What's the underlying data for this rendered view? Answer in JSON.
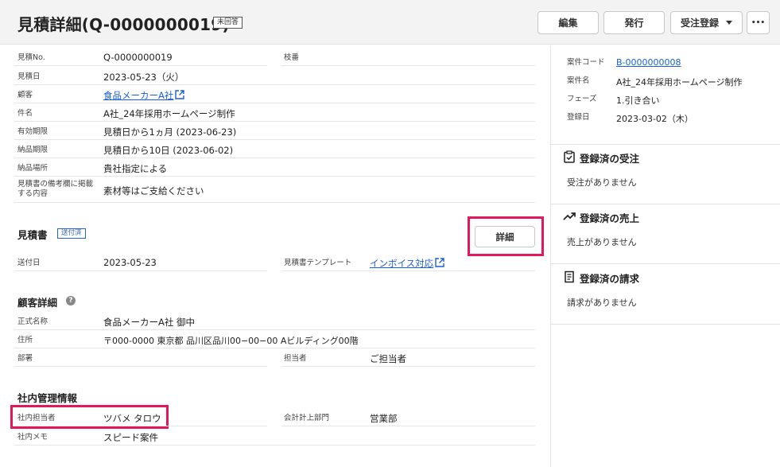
{
  "header": {
    "title": "見積詳細(Q-0000000019)",
    "status_badge": "未回答",
    "buttons": {
      "edit": "編集",
      "issue": "発行",
      "order": "受注登録",
      "more": "•••"
    }
  },
  "basic": {
    "quote_no": {
      "label": "見積No.",
      "value": "Q-0000000019"
    },
    "branch": {
      "label": "枝番",
      "value": ""
    },
    "quote_date": {
      "label": "見積日",
      "value": "2023-05-23（火）"
    },
    "customer": {
      "label": "顧客",
      "value": "食品メーカーA社"
    },
    "subject": {
      "label": "件名",
      "value": "A社_24年採用ホームページ制作"
    },
    "validity": {
      "label": "有効期限",
      "value": "見積日から1ヵ月 (2023-06-23)"
    },
    "delivery_deadline": {
      "label": "納品期限",
      "value": "見積日から10日 (2023-06-02)"
    },
    "delivery_place": {
      "label": "納品場所",
      "value": "貴社指定による"
    },
    "remarks_label_1": "見積書の備考欄に掲載",
    "remarks_label_2": "する内容",
    "remarks": "素材等はご支給ください"
  },
  "quote_doc": {
    "title": "見積書",
    "badge": "送付済",
    "detail_button": "詳細",
    "sent_date": {
      "label": "送付日",
      "value": "2023-05-23"
    },
    "template": {
      "label": "見積書テンプレート",
      "value": "インボイス対応"
    }
  },
  "customer_detail": {
    "title": "顧客詳細",
    "formal_name": {
      "label": "正式名称",
      "value": "食品メーカーA社 御中"
    },
    "address": {
      "label": "住所",
      "value": "〒000-0000 東京都 品川区品川00−00−00 Aビルディング00階"
    },
    "department": {
      "label": "部署",
      "value": ""
    },
    "person": {
      "label": "担当者",
      "value": "ご担当者"
    }
  },
  "internal": {
    "title": "社内管理情報",
    "staff": {
      "label": "社内担当者",
      "value": "ツバメ タロウ"
    },
    "accounting_dept": {
      "label": "会計計上部門",
      "value": "営業部"
    },
    "memo": {
      "label": "社内メモ",
      "value": "スピード案件"
    }
  },
  "sidebar": {
    "project_code": {
      "label": "案件コード",
      "value": "B-0000000008"
    },
    "project_name": {
      "label": "案件名",
      "value": "A社_24年採用ホームページ制作"
    },
    "phase": {
      "label": "フェーズ",
      "value": "1.引き合い"
    },
    "reg_date": {
      "label": "登録日",
      "value": "2023-03-02（木）"
    },
    "orders": {
      "title": "登録済の受注",
      "empty": "受注がありません"
    },
    "sales": {
      "title": "登録済の売上",
      "empty": "売上がありません"
    },
    "invoices": {
      "title": "登録済の請求",
      "empty": "請求がありません"
    }
  },
  "colors": {
    "highlight": "#e01a5a",
    "link": "#1a5fd6"
  }
}
